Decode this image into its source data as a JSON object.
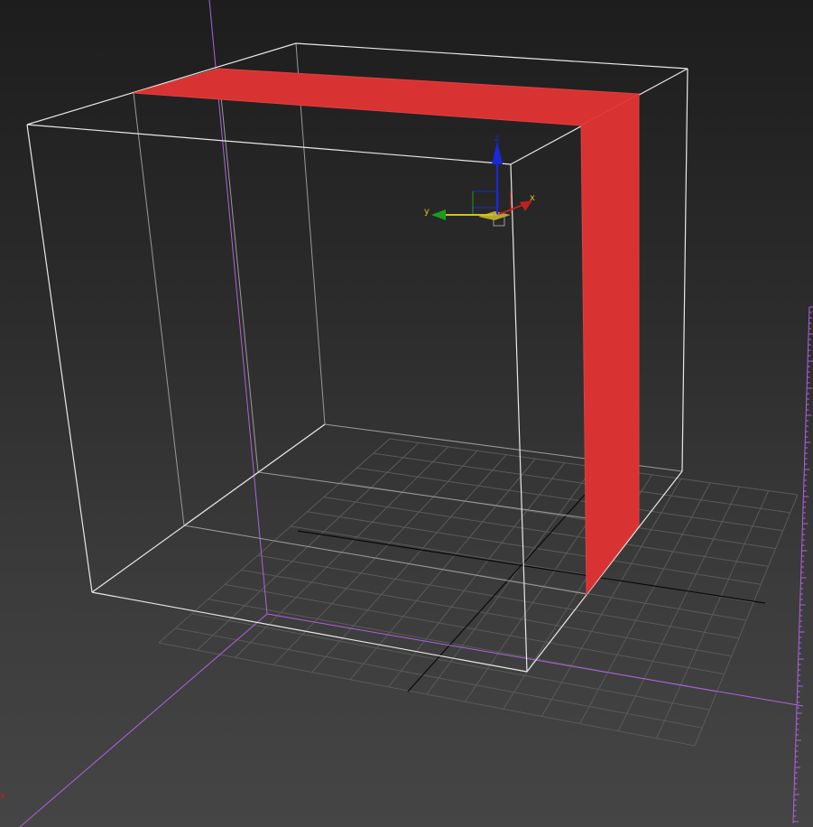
{
  "viewport": {
    "background_top": "#1d1d1d",
    "background_bottom": "#454545"
  },
  "colors": {
    "wireframe": "#e8e8e8",
    "grid": "#5a5a5a",
    "grid_axis": "#0a0a0a",
    "selection_plane": "#d83232",
    "construction_lines": "#b060e0"
  },
  "gizmo": {
    "x_label": "x",
    "y_label": "y",
    "z_label": "z",
    "x_color": "#c02020",
    "y_color": "#1a9e1a",
    "z_color": "#1a28d8",
    "center_color": "#d4c020"
  }
}
